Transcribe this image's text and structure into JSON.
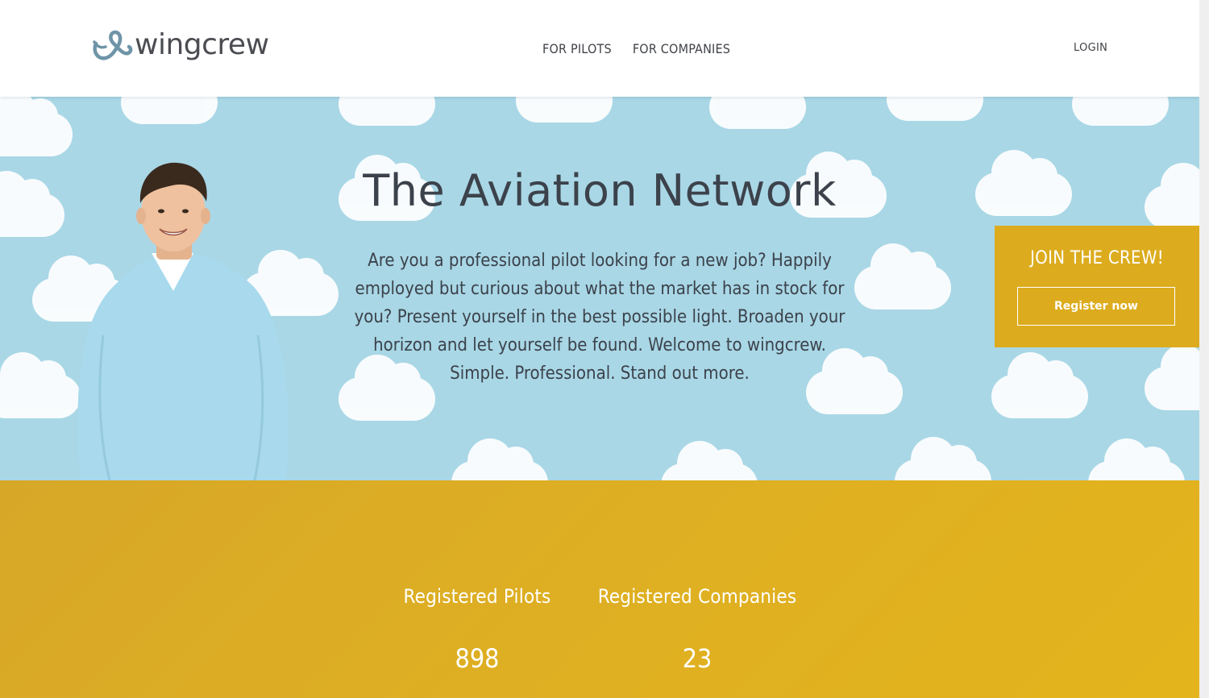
{
  "brand": {
    "logo_text": "wingcrew",
    "logo_icon": "ampersand-wing-icon"
  },
  "nav": {
    "items": [
      {
        "label": "FOR PILOTS"
      },
      {
        "label": "FOR COMPANIES"
      }
    ],
    "login_label": "LOGIN"
  },
  "hero": {
    "title": "The Aviation Network",
    "text": "Are you a professional pilot looking for a new job? Happily employed but curious about what the market has in stock for you? Present yourself in the best possible light. Broaden your horizon and let yourself be found. Welcome to wingcrew. Simple. Professional. Stand out more."
  },
  "join": {
    "title": "JOIN THE CREW!",
    "button_label": "Register now"
  },
  "stats": [
    {
      "label": "Registered Pilots",
      "value": "898"
    },
    {
      "label": "Registered Companies",
      "value": "23"
    }
  ],
  "colors": {
    "accent_yellow": "#dcac1e",
    "sky_blue": "#a9d7e6",
    "text_dark": "#3c424b",
    "logo_blue": "#6f94a8"
  }
}
